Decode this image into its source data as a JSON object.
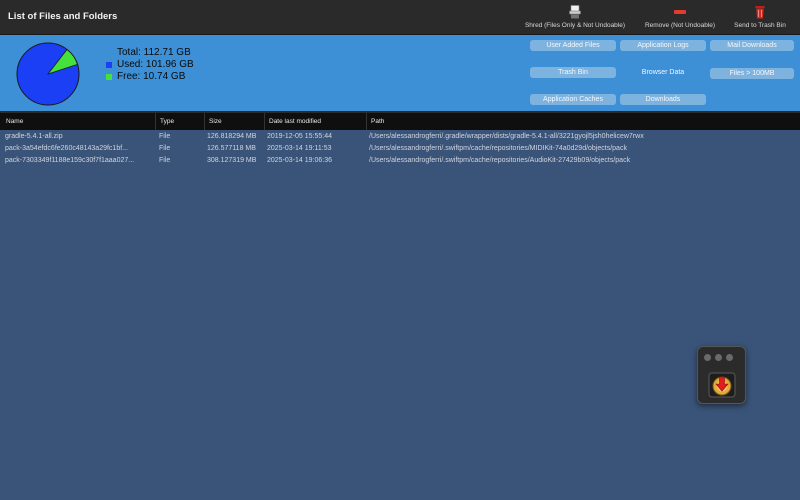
{
  "window": {
    "title": "List of Files and Folders"
  },
  "toolbar": {
    "shred_label": "Shred (Files Only & Not Undoable)",
    "remove_label": "Remove (Not Undoable)",
    "trash_label": "Send to Trash Bin"
  },
  "storage": {
    "total_label": "Total: 112.71 GB",
    "used_label": "Used: 101.96 GB",
    "free_label": "Free: 10.74 GB",
    "used_fraction": 0.9047,
    "used_color": "#1b3ff5",
    "free_color": "#44e23a"
  },
  "categories": {
    "user_added_files": "User Added Files",
    "application_logs": "Application Logs",
    "mail_downloads": "Mail Downloads",
    "trash_bin": "Trash Bin",
    "browser_data": "Browser Data",
    "files_over_100mb": "Files > 100MB",
    "application_caches": "Application Caches",
    "downloads": "Downloads"
  },
  "table": {
    "headers": {
      "name": "Name",
      "type": "Type",
      "size": "Size",
      "date": "Date last modified",
      "path": "Path"
    },
    "rows": [
      {
        "name": "gradle-5.4.1-all.zip",
        "type": "File",
        "size": "126.818294 MB",
        "date": "2019-12-05 15:55:44",
        "path": "/Users/alessandrogferri/.gradle/wrapper/dists/gradle-5.4.1-all/3221gyojl5jsh0helicew7rwx"
      },
      {
        "name": "pack-3a54efdc6fe260c48143a29fc1bf...",
        "type": "File",
        "size": "126.577118 MB",
        "date": "2025-03-14 19:11:53",
        "path": "/Users/alessandrogferri/.swiftpm/cache/repositories/MIDIKit-74a0d29d/objects/pack"
      },
      {
        "name": "pack-7303349f1188e159c30f7f1aaa027...",
        "type": "File",
        "size": "308.127319 MB",
        "date": "2025-03-14 19:06:36",
        "path": "/Users/alessandrogferri/.swiftpm/cache/repositories/AudioKit-27429b09/objects/pack"
      }
    ]
  }
}
